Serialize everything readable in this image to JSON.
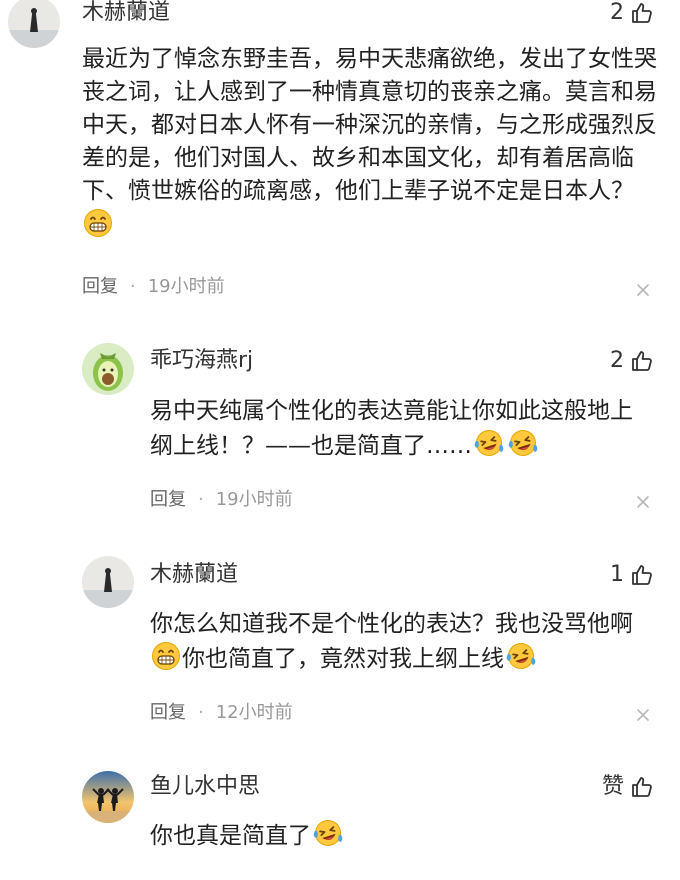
{
  "comments": [
    {
      "username": "木赫蘭道",
      "likes": "2",
      "text_before_emoji": "最近为了悼念东野圭吾，易中天悲痛欲绝，发出了女性哭丧之词，让人感到了一种情真意切的丧亲之痛。莫言和易中天，都对日本人怀有一种深沉的亲情，与之形成强烈反差的是，他们对国人、故乡和本国文化，却有着居高临下、愤世嫉俗的疏离感，他们上辈子说不定是日本人？",
      "emoji": "grin-emoji",
      "reply_label": "回复",
      "separator": "·",
      "time": "19小时前"
    },
    {
      "username": "乖巧海燕rj",
      "likes": "2",
      "text_line1": "易中天纯属个性化的表达竟能让你如此这般地上",
      "text_line2": "纲上线！？——也是简直了……",
      "emoji": "laugh-cry-emoji",
      "reply_label": "回复",
      "separator": "·",
      "time": "19小时前"
    },
    {
      "username": "木赫蘭道",
      "likes": "1",
      "text_line1": "你怎么知道我不是个性化的表达？我也没骂他啊",
      "text_line2": "你也简直了，竟然对我上纲上线",
      "emoji_a": "grin-emoji",
      "emoji_b": "laugh-cry-emoji",
      "reply_label": "回复",
      "separator": "·",
      "time": "12小时前"
    },
    {
      "username": "鱼儿水中思",
      "likes": "赞",
      "text_line1": "你也真是简直了",
      "emoji": "laugh-cry-emoji"
    }
  ],
  "icons": {
    "like": "thumbs-up-icon",
    "close": "close-icon"
  },
  "colors": {
    "text": "#222222",
    "meta": "#999999",
    "emoji_yellow": "#FFC83D",
    "tear_blue": "#4FA3E0",
    "avocado_green": "#8BC34A"
  }
}
